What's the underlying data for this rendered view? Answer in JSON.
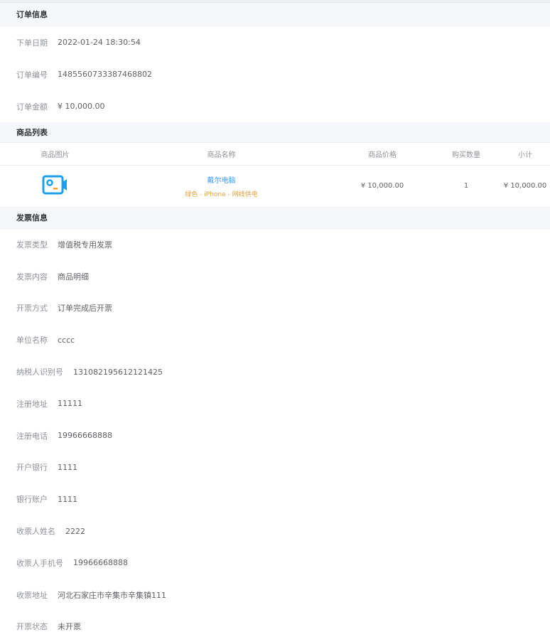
{
  "order_section": {
    "title": "订单信息",
    "fields": [
      {
        "label": "下单日期",
        "value": "2022-01-24 18:30:54"
      },
      {
        "label": "订单编号",
        "value": "1485560733387468802"
      },
      {
        "label": "订单金额",
        "value": "¥ 10,000.00"
      }
    ]
  },
  "goods_section": {
    "title": "商品列表",
    "headers": [
      "商品图片",
      "商品名称",
      "商品价格",
      "购买数量",
      "小计"
    ],
    "rows": [
      {
        "image_icon": "product-icon",
        "name": "戴尔电脑",
        "spec": "绿色 - iPhone - 网线供电",
        "price": "¥ 10,000.00",
        "quantity": "1",
        "subtotal": "¥ 10,000.00"
      }
    ]
  },
  "invoice_section": {
    "title": "发票信息",
    "fields": [
      {
        "label": "发票类型",
        "value": "增值税专用发票"
      },
      {
        "label": "发票内容",
        "value": "商品明细"
      },
      {
        "label": "开票方式",
        "value": "订单完成后开票"
      },
      {
        "label": "单位名称",
        "value": "cccc"
      },
      {
        "label": "纳税人识别号",
        "value": "131082195612121425"
      },
      {
        "label": "注册地址",
        "value": "11111"
      },
      {
        "label": "注册电话",
        "value": "19966668888"
      },
      {
        "label": "开户银行",
        "value": "1111"
      },
      {
        "label": "银行账户",
        "value": "1111"
      },
      {
        "label": "收票人姓名",
        "value": "2222"
      },
      {
        "label": "收票人手机号",
        "value": "19966668888"
      },
      {
        "label": "收票地址",
        "value": "河北石家庄市辛集市辛集镇111"
      },
      {
        "label": "开票状态",
        "value": "未开票"
      }
    ]
  },
  "colors": {
    "link": "#409eff",
    "spec": "#e6a23c",
    "icon": "#1aa1e6"
  }
}
